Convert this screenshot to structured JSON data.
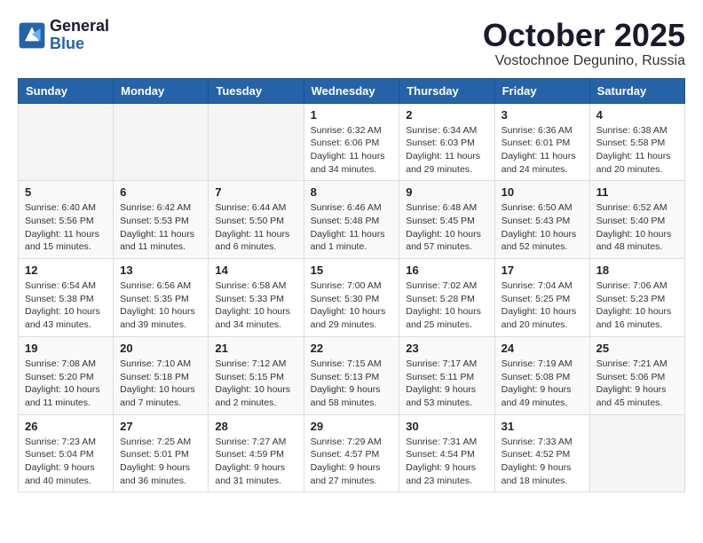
{
  "logo": {
    "line1": "General",
    "line2": "Blue"
  },
  "title": "October 2025",
  "location": "Vostochnoe Degunino, Russia",
  "weekdays": [
    "Sunday",
    "Monday",
    "Tuesday",
    "Wednesday",
    "Thursday",
    "Friday",
    "Saturday"
  ],
  "weeks": [
    [
      {
        "day": "",
        "sunrise": "",
        "sunset": "",
        "daylight": ""
      },
      {
        "day": "",
        "sunrise": "",
        "sunset": "",
        "daylight": ""
      },
      {
        "day": "",
        "sunrise": "",
        "sunset": "",
        "daylight": ""
      },
      {
        "day": "1",
        "sunrise": "Sunrise: 6:32 AM",
        "sunset": "Sunset: 6:06 PM",
        "daylight": "Daylight: 11 hours and 34 minutes."
      },
      {
        "day": "2",
        "sunrise": "Sunrise: 6:34 AM",
        "sunset": "Sunset: 6:03 PM",
        "daylight": "Daylight: 11 hours and 29 minutes."
      },
      {
        "day": "3",
        "sunrise": "Sunrise: 6:36 AM",
        "sunset": "Sunset: 6:01 PM",
        "daylight": "Daylight: 11 hours and 24 minutes."
      },
      {
        "day": "4",
        "sunrise": "Sunrise: 6:38 AM",
        "sunset": "Sunset: 5:58 PM",
        "daylight": "Daylight: 11 hours and 20 minutes."
      }
    ],
    [
      {
        "day": "5",
        "sunrise": "Sunrise: 6:40 AM",
        "sunset": "Sunset: 5:56 PM",
        "daylight": "Daylight: 11 hours and 15 minutes."
      },
      {
        "day": "6",
        "sunrise": "Sunrise: 6:42 AM",
        "sunset": "Sunset: 5:53 PM",
        "daylight": "Daylight: 11 hours and 11 minutes."
      },
      {
        "day": "7",
        "sunrise": "Sunrise: 6:44 AM",
        "sunset": "Sunset: 5:50 PM",
        "daylight": "Daylight: 11 hours and 6 minutes."
      },
      {
        "day": "8",
        "sunrise": "Sunrise: 6:46 AM",
        "sunset": "Sunset: 5:48 PM",
        "daylight": "Daylight: 11 hours and 1 minute."
      },
      {
        "day": "9",
        "sunrise": "Sunrise: 6:48 AM",
        "sunset": "Sunset: 5:45 PM",
        "daylight": "Daylight: 10 hours and 57 minutes."
      },
      {
        "day": "10",
        "sunrise": "Sunrise: 6:50 AM",
        "sunset": "Sunset: 5:43 PM",
        "daylight": "Daylight: 10 hours and 52 minutes."
      },
      {
        "day": "11",
        "sunrise": "Sunrise: 6:52 AM",
        "sunset": "Sunset: 5:40 PM",
        "daylight": "Daylight: 10 hours and 48 minutes."
      }
    ],
    [
      {
        "day": "12",
        "sunrise": "Sunrise: 6:54 AM",
        "sunset": "Sunset: 5:38 PM",
        "daylight": "Daylight: 10 hours and 43 minutes."
      },
      {
        "day": "13",
        "sunrise": "Sunrise: 6:56 AM",
        "sunset": "Sunset: 5:35 PM",
        "daylight": "Daylight: 10 hours and 39 minutes."
      },
      {
        "day": "14",
        "sunrise": "Sunrise: 6:58 AM",
        "sunset": "Sunset: 5:33 PM",
        "daylight": "Daylight: 10 hours and 34 minutes."
      },
      {
        "day": "15",
        "sunrise": "Sunrise: 7:00 AM",
        "sunset": "Sunset: 5:30 PM",
        "daylight": "Daylight: 10 hours and 29 minutes."
      },
      {
        "day": "16",
        "sunrise": "Sunrise: 7:02 AM",
        "sunset": "Sunset: 5:28 PM",
        "daylight": "Daylight: 10 hours and 25 minutes."
      },
      {
        "day": "17",
        "sunrise": "Sunrise: 7:04 AM",
        "sunset": "Sunset: 5:25 PM",
        "daylight": "Daylight: 10 hours and 20 minutes."
      },
      {
        "day": "18",
        "sunrise": "Sunrise: 7:06 AM",
        "sunset": "Sunset: 5:23 PM",
        "daylight": "Daylight: 10 hours and 16 minutes."
      }
    ],
    [
      {
        "day": "19",
        "sunrise": "Sunrise: 7:08 AM",
        "sunset": "Sunset: 5:20 PM",
        "daylight": "Daylight: 10 hours and 11 minutes."
      },
      {
        "day": "20",
        "sunrise": "Sunrise: 7:10 AM",
        "sunset": "Sunset: 5:18 PM",
        "daylight": "Daylight: 10 hours and 7 minutes."
      },
      {
        "day": "21",
        "sunrise": "Sunrise: 7:12 AM",
        "sunset": "Sunset: 5:15 PM",
        "daylight": "Daylight: 10 hours and 2 minutes."
      },
      {
        "day": "22",
        "sunrise": "Sunrise: 7:15 AM",
        "sunset": "Sunset: 5:13 PM",
        "daylight": "Daylight: 9 hours and 58 minutes."
      },
      {
        "day": "23",
        "sunrise": "Sunrise: 7:17 AM",
        "sunset": "Sunset: 5:11 PM",
        "daylight": "Daylight: 9 hours and 53 minutes."
      },
      {
        "day": "24",
        "sunrise": "Sunrise: 7:19 AM",
        "sunset": "Sunset: 5:08 PM",
        "daylight": "Daylight: 9 hours and 49 minutes."
      },
      {
        "day": "25",
        "sunrise": "Sunrise: 7:21 AM",
        "sunset": "Sunset: 5:06 PM",
        "daylight": "Daylight: 9 hours and 45 minutes."
      }
    ],
    [
      {
        "day": "26",
        "sunrise": "Sunrise: 7:23 AM",
        "sunset": "Sunset: 5:04 PM",
        "daylight": "Daylight: 9 hours and 40 minutes."
      },
      {
        "day": "27",
        "sunrise": "Sunrise: 7:25 AM",
        "sunset": "Sunset: 5:01 PM",
        "daylight": "Daylight: 9 hours and 36 minutes."
      },
      {
        "day": "28",
        "sunrise": "Sunrise: 7:27 AM",
        "sunset": "Sunset: 4:59 PM",
        "daylight": "Daylight: 9 hours and 31 minutes."
      },
      {
        "day": "29",
        "sunrise": "Sunrise: 7:29 AM",
        "sunset": "Sunset: 4:57 PM",
        "daylight": "Daylight: 9 hours and 27 minutes."
      },
      {
        "day": "30",
        "sunrise": "Sunrise: 7:31 AM",
        "sunset": "Sunset: 4:54 PM",
        "daylight": "Daylight: 9 hours and 23 minutes."
      },
      {
        "day": "31",
        "sunrise": "Sunrise: 7:33 AM",
        "sunset": "Sunset: 4:52 PM",
        "daylight": "Daylight: 9 hours and 18 minutes."
      },
      {
        "day": "",
        "sunrise": "",
        "sunset": "",
        "daylight": ""
      }
    ]
  ]
}
